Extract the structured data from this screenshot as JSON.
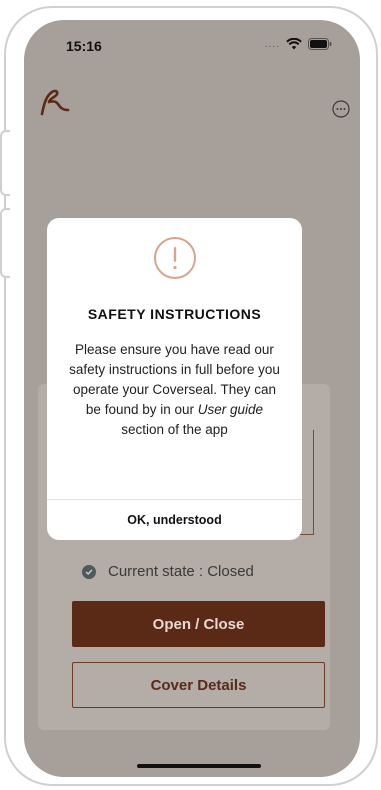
{
  "status_bar": {
    "time": "15:16",
    "signal": "....",
    "wifi_icon": "wifi-icon",
    "battery_icon": "battery-icon"
  },
  "header": {
    "logo_icon": "coverseal-logo-icon",
    "menu_icon": "more-icon"
  },
  "main": {
    "current_state_label": "Current state : Closed",
    "open_close_label": "Open / Close",
    "cover_details_label": "Cover Details"
  },
  "modal": {
    "title": "SAFETY INSTRUCTIONS",
    "body_pre": "Please ensure you have read our safety instructions in full before you operate your Coverseal. They can be found by in our ",
    "body_link": "User guide",
    "body_post": " section of the app",
    "ok_label": "OK, understood"
  },
  "colors": {
    "accent": "#5a2a17",
    "overlay": "#a79f99",
    "warning": "#d9a48e"
  }
}
